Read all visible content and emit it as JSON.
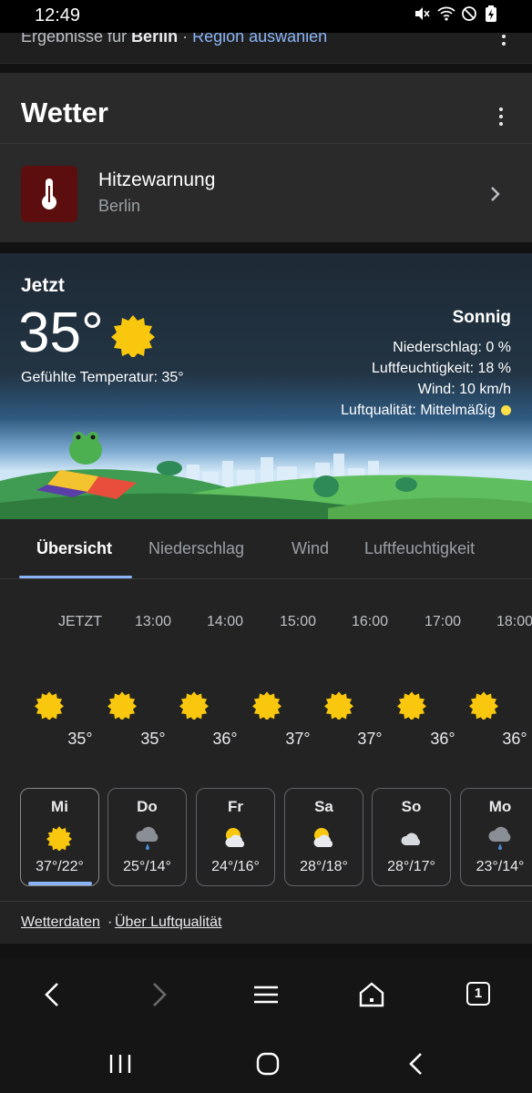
{
  "status_bar": {
    "time": "12:49",
    "icons": [
      "mute-icon",
      "wifi-icon",
      "dnd-icon",
      "battery-charging-icon"
    ]
  },
  "results_bar": {
    "prefix": "Ergebnisse für ",
    "place": "Berlin",
    "separator": " · ",
    "link": "Region auswählen"
  },
  "header": {
    "title": "Wetter"
  },
  "warning": {
    "title": "Hitzewarnung",
    "location": "Berlin",
    "icon": "thermometer-icon",
    "badge_color": "#5c0e0e"
  },
  "current": {
    "label": "Jetzt",
    "temperature": "35°",
    "feels_like": "Gefühlte Temperatur: 35°",
    "condition": "Sonnig",
    "precipitation": "Niederschlag: 0 %",
    "humidity": "Luftfeuchtigkeit: 18 %",
    "wind": "Wind: 10 km/h",
    "air_quality": "Luftqualität: Mittelmäßig",
    "icon": "sun-icon"
  },
  "tabs": [
    {
      "label": "Übersicht",
      "active": true
    },
    {
      "label": "Niederschlag",
      "active": false
    },
    {
      "label": "Wind",
      "active": false
    },
    {
      "label": "Luftfeuchtigkeit",
      "active": false
    }
  ],
  "hourly": [
    {
      "time": "JETZT",
      "temp": "35°",
      "icon": "sun-icon"
    },
    {
      "time": "13:00",
      "temp": "35°",
      "icon": "sun-icon"
    },
    {
      "time": "14:00",
      "temp": "36°",
      "icon": "sun-icon"
    },
    {
      "time": "15:00",
      "temp": "37°",
      "icon": "sun-icon"
    },
    {
      "time": "16:00",
      "temp": "37°",
      "icon": "sun-icon"
    },
    {
      "time": "17:00",
      "temp": "36°",
      "icon": "sun-icon"
    },
    {
      "time": "18:00",
      "temp": "36°",
      "icon": "sun-icon"
    }
  ],
  "daily": [
    {
      "day": "Mi",
      "temps": "37°/22°",
      "icon": "sun-icon",
      "selected": true
    },
    {
      "day": "Do",
      "temps": "25°/14°",
      "icon": "rain-cloud-icon",
      "selected": false
    },
    {
      "day": "Fr",
      "temps": "24°/16°",
      "icon": "partly-cloudy-icon",
      "selected": false
    },
    {
      "day": "Sa",
      "temps": "28°/18°",
      "icon": "partly-cloudy-icon",
      "selected": false
    },
    {
      "day": "So",
      "temps": "28°/17°",
      "icon": "cloud-icon",
      "selected": false
    },
    {
      "day": "Mo",
      "temps": "23°/14°",
      "icon": "rain-cloud-icon",
      "selected": false
    }
  ],
  "footer": {
    "link_data": "Wetterdaten",
    "separator": "·",
    "link_air": "Über Luftqualität"
  },
  "browser_toolbar": {
    "tab_count": "1"
  },
  "colors": {
    "accent": "#8ab4f8",
    "sun": "#f9c80e",
    "air_quality_dot": "#fde047"
  }
}
